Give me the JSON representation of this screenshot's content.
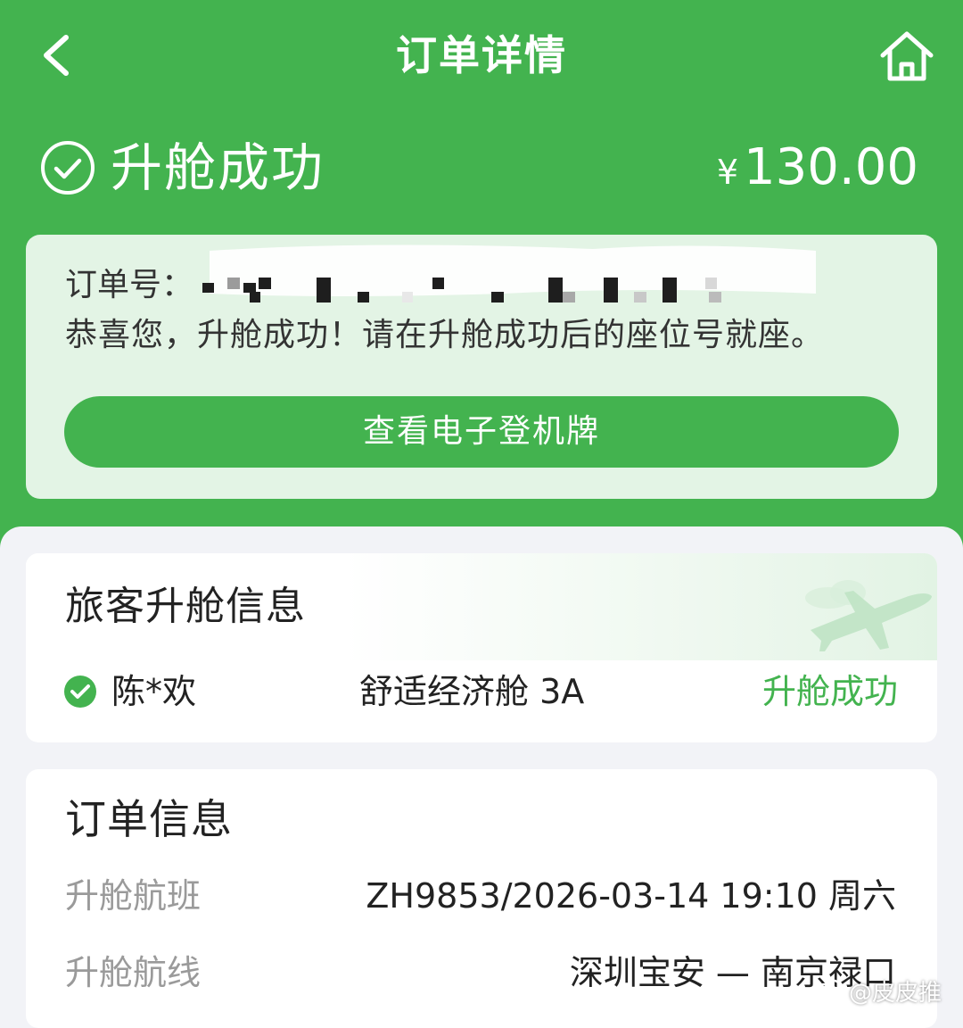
{
  "header": {
    "title": "订单详情",
    "back_icon": "chevron-left-icon",
    "home_icon": "home-icon"
  },
  "status": {
    "icon": "check-circle-icon",
    "text": "升舱成功",
    "currency_symbol": "¥",
    "amount": "130.00"
  },
  "order_card": {
    "order_no_label": "订单号：",
    "message": "恭喜您，升舱成功！请在升舱成功后的座位号就座。",
    "boarding_pass_button": "查看电子登机牌"
  },
  "passenger_section": {
    "title": "旅客升舱信息",
    "passengers": [
      {
        "name": "陈*欢",
        "seat": "舒适经济舱 3A",
        "status": "升舱成功"
      }
    ]
  },
  "order_info": {
    "title": "订单信息",
    "rows": [
      {
        "label": "升舱航班",
        "value": "ZH9853/2026-03-14 19:10 周六"
      },
      {
        "label": "升舱航线",
        "value": "深圳宝安 — 南京禄口"
      }
    ]
  },
  "watermark": {
    "text": "@皮皮推"
  },
  "colors": {
    "primary_green": "#43b34f",
    "light_green_card": "#e3f4e5",
    "page_background": "#f2f3f7",
    "label_gray": "#9a9a9a"
  }
}
